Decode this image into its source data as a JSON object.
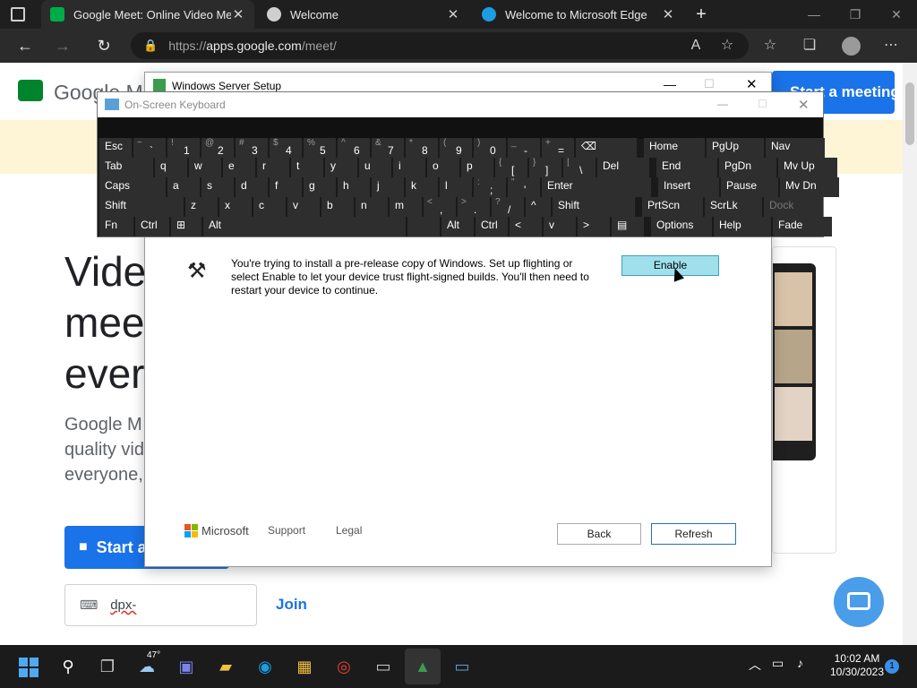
{
  "browser": {
    "tabs": [
      {
        "label": "Google Meet: Online Video Meetings",
        "active": true
      },
      {
        "label": "Welcome",
        "active": false
      },
      {
        "label": "Welcome to Microsoft Edge",
        "active": false
      }
    ],
    "new_tab_glyph": "+",
    "address": {
      "scheme": "https://",
      "host": "apps.google.com",
      "path": "/meet/"
    }
  },
  "meet": {
    "logo_text": "Google M",
    "header_button": "Start a meeting",
    "hero_lines": [
      "Vide",
      "meet",
      "ever"
    ],
    "sub_lines": [
      "Google M",
      "quality vid",
      "everyone,"
    ],
    "start_label": "Start a",
    "code_input_value": "dpx-",
    "join_label": "Join"
  },
  "setup": {
    "title": "Windows Server Setup",
    "message": "You're trying to install a pre-release copy of Windows. Set up flighting or select Enable to let your device trust flight-signed builds. You'll then need to restart your device to continue.",
    "enable_label": "Enable",
    "brand": "Microsoft",
    "support_label": "Support",
    "legal_label": "Legal",
    "back_label": "Back",
    "refresh_label": "Refresh"
  },
  "osk": {
    "title": "On-Screen Keyboard",
    "rows": [
      [
        {
          "l": "Esc"
        },
        {
          "s": "~",
          "m": "`"
        },
        {
          "s": "!",
          "m": "1"
        },
        {
          "s": "@",
          "m": "2"
        },
        {
          "s": "#",
          "m": "3"
        },
        {
          "s": "$",
          "m": "4"
        },
        {
          "s": "%",
          "m": "5"
        },
        {
          "s": "^",
          "m": "6"
        },
        {
          "s": "&",
          "m": "7"
        },
        {
          "s": "*",
          "m": "8"
        },
        {
          "s": "(",
          "m": "9"
        },
        {
          "s": ")",
          "m": "0"
        },
        {
          "s": "_",
          "m": "-"
        },
        {
          "s": "+",
          "m": "="
        },
        {
          "l": "⌫"
        },
        {
          "l": "Home"
        },
        {
          "l": "PgUp"
        },
        {
          "l": "Nav"
        }
      ],
      [
        {
          "l": "Tab"
        },
        {
          "l": "q"
        },
        {
          "l": "w"
        },
        {
          "l": "e"
        },
        {
          "l": "r"
        },
        {
          "l": "t"
        },
        {
          "l": "y"
        },
        {
          "l": "u"
        },
        {
          "l": "i"
        },
        {
          "l": "o"
        },
        {
          "l": "p"
        },
        {
          "s": "{",
          "m": "["
        },
        {
          "s": "}",
          "m": "]"
        },
        {
          "s": "|",
          "m": "\\"
        },
        {
          "l": "Del"
        },
        {
          "l": "End"
        },
        {
          "l": "PgDn"
        },
        {
          "l": "Mv Up"
        }
      ],
      [
        {
          "l": "Caps"
        },
        {
          "l": "a"
        },
        {
          "l": "s"
        },
        {
          "l": "d"
        },
        {
          "l": "f"
        },
        {
          "l": "g"
        },
        {
          "l": "h"
        },
        {
          "l": "j"
        },
        {
          "l": "k"
        },
        {
          "l": "l"
        },
        {
          "s": ":",
          "m": ";"
        },
        {
          "s": "\"",
          "m": "'"
        },
        {
          "l": "Enter"
        },
        {
          "l": "Insert"
        },
        {
          "l": "Pause"
        },
        {
          "l": "Mv Dn"
        }
      ],
      [
        {
          "l": "Shift"
        },
        {
          "l": "z"
        },
        {
          "l": "x"
        },
        {
          "l": "c"
        },
        {
          "l": "v"
        },
        {
          "l": "b"
        },
        {
          "l": "n"
        },
        {
          "l": "m"
        },
        {
          "s": "<",
          "m": ","
        },
        {
          "s": ">",
          "m": "."
        },
        {
          "s": "?",
          "m": "/"
        },
        {
          "l": "^"
        },
        {
          "l": "Shift"
        },
        {
          "l": "PrtScn"
        },
        {
          "l": "ScrLk"
        },
        {
          "l": "Dock",
          "dim": true
        }
      ],
      [
        {
          "l": "Fn"
        },
        {
          "l": "Ctrl"
        },
        {
          "l": "⊞"
        },
        {
          "l": "Alt"
        },
        {
          "l": ""
        },
        {
          "l": "Alt"
        },
        {
          "l": "Ctrl"
        },
        {
          "l": "<"
        },
        {
          "l": "v"
        },
        {
          "l": ">"
        },
        {
          "l": "▤"
        },
        {
          "l": "Options"
        },
        {
          "l": "Help"
        },
        {
          "l": "Fade"
        }
      ]
    ]
  },
  "taskbar": {
    "weather": "47°",
    "time": "10:02 AM",
    "date": "10/30/2023",
    "notifications": "1"
  },
  "colors": {
    "accent": "#1a73e8",
    "enable": "#9fe0ec",
    "taskbar": "#1b1b1b"
  }
}
